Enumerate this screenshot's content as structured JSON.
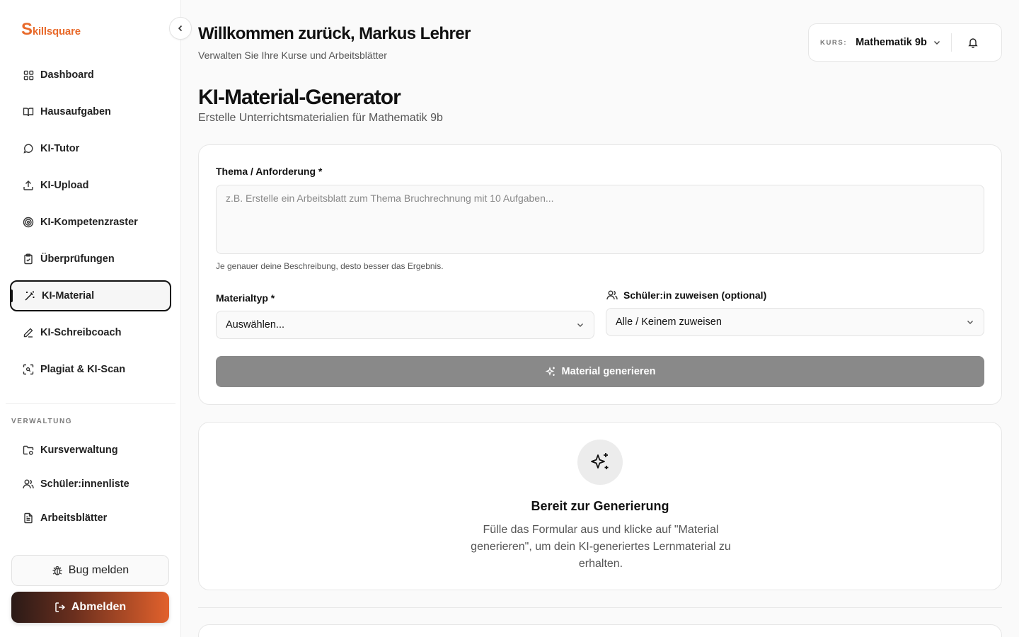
{
  "brand": {
    "logo_first": "S",
    "logo_rest": "killsquare"
  },
  "sidebar": {
    "items": [
      {
        "label": "Dashboard",
        "icon": "dashboard-grid-icon"
      },
      {
        "label": "Hausaufgaben",
        "icon": "book-open-icon"
      },
      {
        "label": "KI-Tutor",
        "icon": "chat-bubble-icon"
      },
      {
        "label": "KI-Upload",
        "icon": "upload-icon"
      },
      {
        "label": "KI-Kompetenzraster",
        "icon": "target-icon"
      },
      {
        "label": "Überprüfungen",
        "icon": "clipboard-check-icon"
      },
      {
        "label": "KI-Material",
        "icon": "magic-wand-icon",
        "active": true
      },
      {
        "label": "KI-Schreibcoach",
        "icon": "pen-icon"
      },
      {
        "label": "Plagiat & KI-Scan",
        "icon": "scan-icon"
      }
    ],
    "section_label": "VERWALTUNG",
    "admin_items": [
      {
        "label": "Kursverwaltung",
        "icon": "folder-settings-icon"
      },
      {
        "label": "Schüler:innenliste",
        "icon": "users-icon"
      },
      {
        "label": "Arbeitsblätter",
        "icon": "document-icon"
      }
    ],
    "bug_label": "Bug melden",
    "logout_label": "Abmelden"
  },
  "header": {
    "welcome": "Willkommen zurück, Markus Lehrer",
    "subtitle": "Verwalten Sie Ihre Kurse und Arbeitsblätter",
    "course_label": "KURS:",
    "course_value": "Mathematik 9b"
  },
  "page": {
    "title": "KI-Material-Generator",
    "subtitle": "Erstelle Unterrichtsmaterialien für Mathematik 9b"
  },
  "form": {
    "topic_label": "Thema / Anforderung *",
    "topic_placeholder": "z.B. Erstelle ein Arbeitsblatt zum Thema Bruchrechnung mit 10 Aufgaben...",
    "topic_hint": "Je genauer deine Beschreibung, desto besser das Ergebnis.",
    "type_label": "Materialtyp *",
    "type_value": "Auswählen...",
    "assign_label": "Schüler:in zuweisen (optional)",
    "assign_value": "Alle / Keinem zuweisen",
    "generate_label": "Material generieren"
  },
  "empty_state": {
    "title": "Bereit zur Generierung",
    "description": "Fülle das Formular aus und klicke auf \"Material generieren\", um dein KI-generiertes Lernmaterial zu erhalten."
  },
  "colors": {
    "accent": "#e86a2b",
    "button_disabled": "#898989",
    "text": "#111111"
  }
}
